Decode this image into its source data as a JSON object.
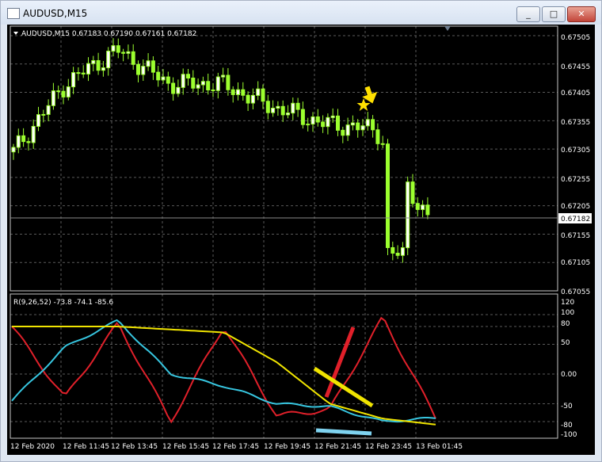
{
  "window": {
    "title": "AUDUSD,M15",
    "buttons": [
      "_",
      "□",
      "✕"
    ]
  },
  "price_panel": {
    "header": "AUDUSD,M15  0.67183 0.67190 0.67161 0.67182",
    "current_price": "0.67182",
    "ticks": [
      "0.67505",
      "0.67455",
      "0.67405",
      "0.67355",
      "0.67305",
      "0.67255",
      "0.67205",
      "0.67155",
      "0.67105",
      "0.67055"
    ]
  },
  "indicator_panel": {
    "header": "R(9,26,52) -73.8 -74.1 -85.6",
    "ticks": [
      "120",
      "100",
      "80",
      "50",
      "0.00",
      "-50",
      "-80",
      "-100"
    ]
  },
  "time_axis": [
    "12 Feb 2020",
    "12 Feb 11:45",
    "12 Feb 13:45",
    "12 Feb 15:45",
    "12 Feb 17:45",
    "12 Feb 19:45",
    "12 Feb 21:45",
    "12 Feb 23:45",
    "13 Feb 01:45"
  ],
  "colors": {
    "background": "#000000",
    "grid": "#5a5a5a",
    "candle": "#9cff2f",
    "red_line": "#e0202a",
    "aqua_line": "#37c6e0",
    "yellow_line": "#f0e400",
    "arrow": "#ffe000",
    "star": "#ffe000"
  },
  "chart_data": [
    {
      "type": "line",
      "title": "AUDUSD,M15",
      "x": [
        "12 Feb 2020",
        "12 Feb 11:45",
        "12 Feb 13:45",
        "12 Feb 15:45",
        "12 Feb 17:45",
        "12 Feb 19:45",
        "12 Feb 21:45",
        "12 Feb 23:45",
        "13 Feb 01:45"
      ],
      "series": [
        {
          "name": "",
          "values": [
            0.673,
            0.6742,
            0.6748,
            0.6742,
            0.6742,
            0.6738,
            0.6735,
            0.6734,
            0.6718
          ]
        }
      ],
      "ylim": [
        0.67055,
        0.67505
      ],
      "grid": true
    },
    {
      "type": "line",
      "title": "R(9,26,52) -73.8 -74.1 -85.6",
      "x": [
        "12 Feb 2020",
        "12 Feb 11:45",
        "12 Feb 13:45",
        "12 Feb 15:45",
        "12 Feb 17:45",
        "12 Feb 19:45",
        "12 Feb 21:45",
        "12 Feb 23:45",
        "13 Feb 01:45"
      ],
      "series": [
        {
          "name": "",
          "values": [
            80,
            -40,
            85,
            -80,
            80,
            -70,
            -60,
            95,
            -74
          ]
        },
        {
          "name": "",
          "values": [
            -45,
            45,
            90,
            0,
            -20,
            -50,
            -55,
            -80,
            -74
          ]
        },
        {
          "name": "",
          "values": [
            80,
            80,
            80,
            75,
            70,
            20,
            -50,
            -75,
            -85
          ]
        }
      ],
      "ylim": [
        -100,
        120
      ],
      "grid": true
    }
  ]
}
